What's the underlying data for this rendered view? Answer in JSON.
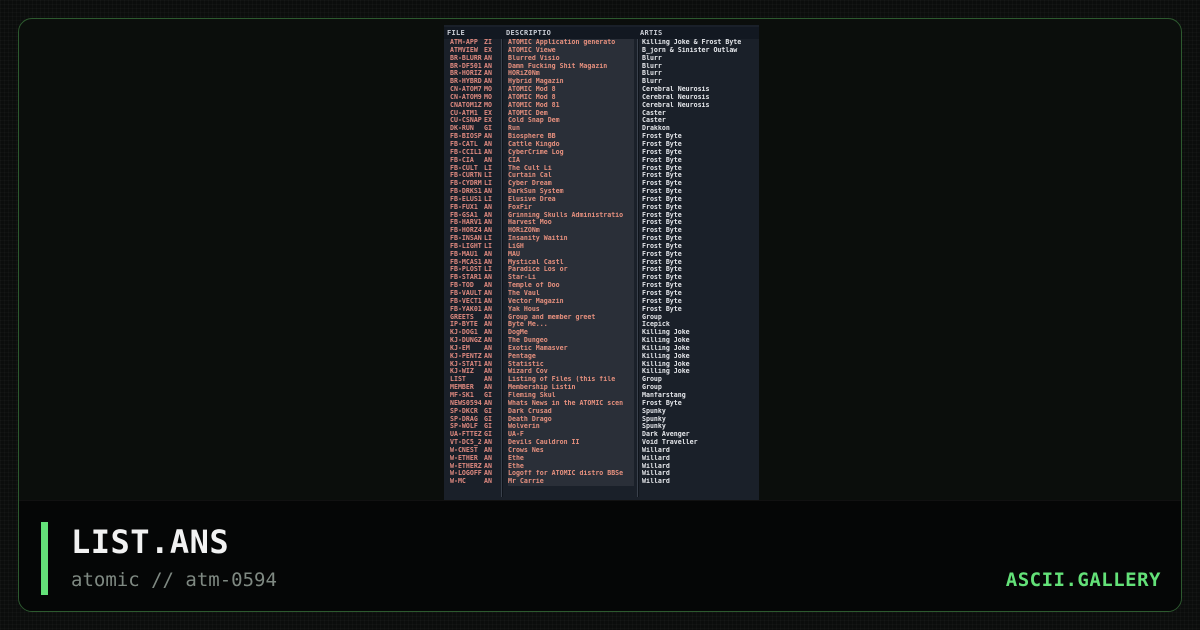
{
  "art": {
    "columns": [
      "FILE",
      "DESCRIPTIO",
      "ARTIS"
    ],
    "rows": [
      {
        "file": "ATM-APP",
        "ext": "ZI",
        "desc": "ATOMIC Application generato",
        "artist": "Killing Joke & Frost Byte"
      },
      {
        "file": "ATMVIEW",
        "ext": "EX",
        "desc": "ATOMIC Viewe",
        "artist": "B_jorn & Sinister Outlaw"
      },
      {
        "file": "BR-BLURR",
        "ext": "AN",
        "desc": "Blurred Visio",
        "artist": "Blurr"
      },
      {
        "file": "BR-DF501",
        "ext": "AN",
        "desc": "Damn Fucking Shit Magazin",
        "artist": "Blurr"
      },
      {
        "file": "BR-HORIZ",
        "ext": "AN",
        "desc": "HORiZ0Nm",
        "artist": "Blurr"
      },
      {
        "file": "BR-HYBRD",
        "ext": "AN",
        "desc": "Hybrid Magazin",
        "artist": "Blurr"
      },
      {
        "file": "CN-ATOM7",
        "ext": "MO",
        "desc": "ATOMIC Mod 8",
        "artist": "Cerebral Neurosis"
      },
      {
        "file": "CN-ATOM9",
        "ext": "MO",
        "desc": "ATOMIC Mod 8",
        "artist": "Cerebral Neurosis"
      },
      {
        "file": "CNATOM1Z",
        "ext": "MO",
        "desc": "ATOMIC Mod 81",
        "artist": "Cerebral Neurosis"
      },
      {
        "file": "CU-ATM1",
        "ext": "EX",
        "desc": "ATOMIC Dem",
        "artist": "Caster"
      },
      {
        "file": "CU-CSNAP",
        "ext": "EX",
        "desc": "Cold Snap Dem",
        "artist": "Caster"
      },
      {
        "file": "DK-RUN",
        "ext": "GI",
        "desc": "Run",
        "artist": "Drakkon"
      },
      {
        "file": "FB-BIOSP",
        "ext": "AN",
        "desc": "Biosphere BB",
        "artist": "Frost Byte"
      },
      {
        "file": "FB-CATL",
        "ext": "AN",
        "desc": "Cattle Kingdo",
        "artist": "Frost Byte"
      },
      {
        "file": "FB-CCIL1",
        "ext": "AN",
        "desc": "CyberCrime Log",
        "artist": "Frost Byte"
      },
      {
        "file": "FB-CIA",
        "ext": "AN",
        "desc": "CIA",
        "artist": "Frost Byte"
      },
      {
        "file": "FB-CULT",
        "ext": "LI",
        "desc": "The Cult Li",
        "artist": "Frost Byte"
      },
      {
        "file": "FB-CURTN",
        "ext": "LI",
        "desc": "Curtain Cal",
        "artist": "Frost Byte"
      },
      {
        "file": "FB-CYDRM",
        "ext": "LI",
        "desc": "Cyber Dream",
        "artist": "Frost Byte"
      },
      {
        "file": "FB-DRKS1",
        "ext": "AN",
        "desc": "DarkSun System",
        "artist": "Frost Byte"
      },
      {
        "file": "FB-ELUS1",
        "ext": "LI",
        "desc": "Elusive Drea",
        "artist": "Frost Byte"
      },
      {
        "file": "FB-FUX1",
        "ext": "AN",
        "desc": "FoxFir",
        "artist": "Frost Byte"
      },
      {
        "file": "FB-GSA1",
        "ext": "AN",
        "desc": "Grinning Skulls Administratio",
        "artist": "Frost Byte"
      },
      {
        "file": "FB-HARV1",
        "ext": "AN",
        "desc": "Harvest Moo",
        "artist": "Frost Byte"
      },
      {
        "file": "FB-HORZ4",
        "ext": "AN",
        "desc": "HORiZONm",
        "artist": "Frost Byte"
      },
      {
        "file": "FB-INSAN",
        "ext": "LI",
        "desc": "Insanity Waitin",
        "artist": "Frost Byte"
      },
      {
        "file": "FB-LIGHT",
        "ext": "LI",
        "desc": "LiGH",
        "artist": "Frost Byte"
      },
      {
        "file": "FB-MAU1",
        "ext": "AN",
        "desc": "MAU",
        "artist": "Frost Byte"
      },
      {
        "file": "FB-MCAS1",
        "ext": "AN",
        "desc": "Mystical Castl",
        "artist": "Frost Byte"
      },
      {
        "file": "FB-PLOST",
        "ext": "LI",
        "desc": "Paradice Los or",
        "artist": "Frost Byte"
      },
      {
        "file": "FB-STAR1",
        "ext": "AN",
        "desc": "Star-Li",
        "artist": "Frost Byte"
      },
      {
        "file": "FB-TOD",
        "ext": "AN",
        "desc": "Temple of Doo",
        "artist": "Frost Byte"
      },
      {
        "file": "FB-VAULT",
        "ext": "AN",
        "desc": "The Vaul",
        "artist": "Frost Byte"
      },
      {
        "file": "FB-VECT1",
        "ext": "AN",
        "desc": "Vector Magazin",
        "artist": "Frost Byte"
      },
      {
        "file": "FB-YAK01",
        "ext": "AN",
        "desc": "Yak Hous",
        "artist": "Frost Byte"
      },
      {
        "file": "GREETS",
        "ext": "AN",
        "desc": "Group and member greet",
        "artist": "Group"
      },
      {
        "file": "IP-BYTE",
        "ext": "AN",
        "desc": "Byte Me...",
        "artist": "Icepick"
      },
      {
        "file": "KJ-DOG1",
        "ext": "AN",
        "desc": "DogMe",
        "artist": "Killing Joke"
      },
      {
        "file": "KJ-DUNGZ",
        "ext": "AN",
        "desc": "The Dungeo",
        "artist": "Killing Joke"
      },
      {
        "file": "KJ-EM",
        "ext": "AN",
        "desc": "Exotic Mamasver",
        "artist": "Killing Joke"
      },
      {
        "file": "KJ-PENTZ",
        "ext": "AN",
        "desc": "Pentage",
        "artist": "Killing Joke"
      },
      {
        "file": "KJ-STAT1",
        "ext": "AN",
        "desc": "Statistic",
        "artist": "Killing Joke"
      },
      {
        "file": "KJ-WIZ",
        "ext": "AN",
        "desc": "Wizard Cov",
        "artist": "Killing Joke"
      },
      {
        "file": "LIST",
        "ext": "AN",
        "desc": "Listing of Files (this file",
        "artist": "Group"
      },
      {
        "file": "MEMBER",
        "ext": "AN",
        "desc": "Membership Listin",
        "artist": "Group"
      },
      {
        "file": "MF-SK1",
        "ext": "GI",
        "desc": "Fleming Skul",
        "artist": "Manfarstang"
      },
      {
        "file": "NEWS0594",
        "ext": "AN",
        "desc": "Whats News in the ATOMIC scen",
        "artist": "Frost Byte"
      },
      {
        "file": "SP-DKCR",
        "ext": "GI",
        "desc": "Dark Crusad",
        "artist": "Spunky"
      },
      {
        "file": "SP-DRAG",
        "ext": "GI",
        "desc": "Death Drago",
        "artist": "Spunky"
      },
      {
        "file": "SP-WOLF",
        "ext": "GI",
        "desc": "Wolverin",
        "artist": "Spunky"
      },
      {
        "file": "UA-FTTEZ",
        "ext": "GI",
        "desc": "UA-F",
        "artist": "Dark Avenger"
      },
      {
        "file": "VT-DC5_2",
        "ext": "AN",
        "desc": "Devils Cauldron II",
        "artist": "Void Traveller"
      },
      {
        "file": "W-CNEST",
        "ext": "AN",
        "desc": "Crows Nes",
        "artist": "Willard"
      },
      {
        "file": "W-ETHER",
        "ext": "AN",
        "desc": "Ethe",
        "artist": "Willard"
      },
      {
        "file": "W-ETHERZ",
        "ext": "AN",
        "desc": "Ethe",
        "artist": "Willard"
      },
      {
        "file": "W-LOGOFF",
        "ext": "AN",
        "desc": "Logoff for ATOMIC distro BBSe",
        "artist": "Willard"
      },
      {
        "file": "W-MC",
        "ext": "AN",
        "desc": "Mr Carrie",
        "artist": "Willard"
      }
    ]
  },
  "footer": {
    "title": "LIST.ANS",
    "subtitle": "atomic // atm-0594",
    "brand": "ASCII.GALLERY"
  },
  "colors": {
    "accent": "#63e178",
    "frame_border": "#2d5a2f",
    "art_bg": "#1a2029",
    "art_text_red": "#e08a80",
    "art_text_white": "#e4e6ea"
  }
}
